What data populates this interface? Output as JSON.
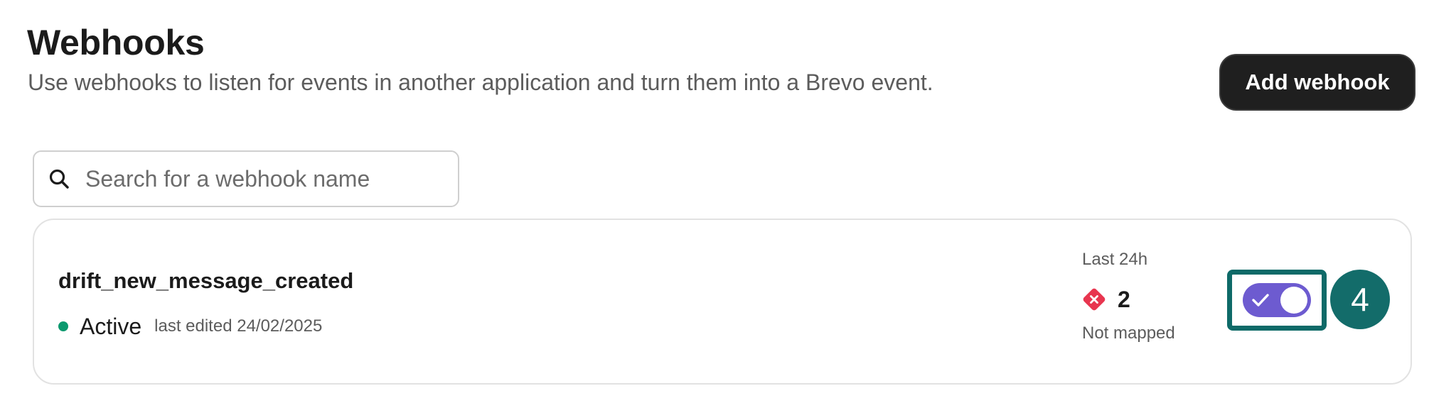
{
  "header": {
    "title": "Webhooks",
    "subtitle": "Use webhooks to listen for events in another application and turn them into a Brevo event.",
    "add_button_label": "Add webhook"
  },
  "search": {
    "placeholder": "Search for a webhook name",
    "value": "",
    "icon": "search-icon"
  },
  "webhooks": [
    {
      "name": "drift_new_message_created",
      "status": "Active",
      "status_color": "#0b996e",
      "last_edited": "last edited 24/02/2025",
      "stats": {
        "period": "Last 24h",
        "count": "2",
        "label": "Not mapped",
        "icon": "error-x-icon",
        "icon_color": "#e8354f"
      },
      "enabled": true,
      "toggle_color": "#6d5bd0"
    }
  ],
  "annotation": {
    "step_number": "4",
    "color": "#136c6a"
  }
}
